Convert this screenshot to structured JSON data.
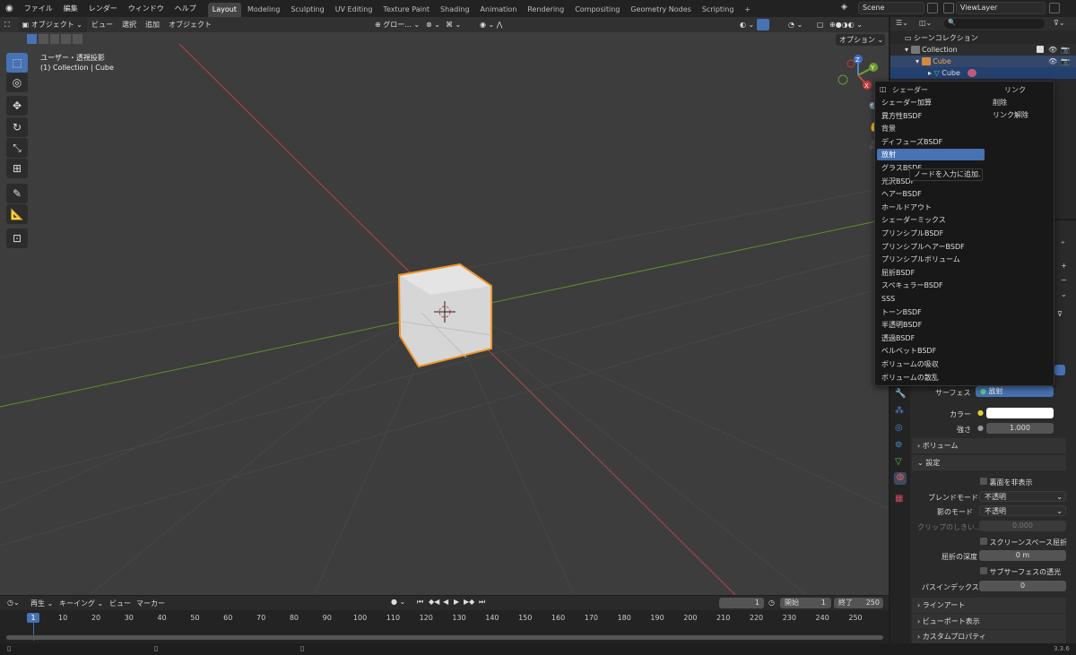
{
  "topbar": {
    "menus": [
      "ファイル",
      "編集",
      "レンダー",
      "ウィンドウ",
      "ヘルプ"
    ],
    "workspaces": [
      "Layout",
      "Modeling",
      "Sculpting",
      "UV Editing",
      "Texture Paint",
      "Shading",
      "Animation",
      "Rendering",
      "Compositing",
      "Geometry Nodes",
      "Scripting"
    ],
    "add_tab": "+",
    "scene": "Scene",
    "viewlayer": "ViewLayer"
  },
  "viewport": {
    "mode": "オブジェクト",
    "menus": [
      "ビュー",
      "選択",
      "追加",
      "オブジェクト"
    ],
    "transform": "グロー...",
    "options": "オプション",
    "title": "ユーザー・透視投影",
    "subtitle": "(1) Collection | Cube",
    "axes": {
      "x": "X",
      "y": "Y",
      "z": "Z"
    }
  },
  "outliner": {
    "scene_collection": "シーンコレクション",
    "collection": "Collection",
    "cube": "Cube",
    "mesh": "Cube"
  },
  "menu": {
    "col1_header": "シェーダー",
    "col2_header": "リンク",
    "items": [
      "シェーダー加算",
      "異方性BSDF",
      "背景",
      "ディフューズBSDF",
      "放射",
      "グラスBSDF",
      "光沢BSDF",
      "ヘアーBSDF",
      "ホールドアウト",
      "シェーダーミックス",
      "プリンシプルBSDF",
      "プリンシプルヘアーBSDF",
      "プリンシプルボリューム",
      "屈折BSDF",
      "スペキュラーBSDF",
      "SSS",
      "トーンBSDF",
      "半透明BSDF",
      "透過BSDF",
      "ベルベットBSDF",
      "ボリュームの吸収",
      "ボリュームの散乱"
    ],
    "col2_items": [
      "削除",
      "リンク解除"
    ],
    "highlighted_index": 4,
    "tooltip": "ノードを入力に追加."
  },
  "properties": {
    "surface_label": "サーフェス",
    "surface_value": "放射",
    "color_label": "カラー",
    "strength_label": "強さ",
    "strength_value": "1.000",
    "volume": "ボリューム",
    "settings": "設定",
    "backface": "裏面を非表示",
    "blend_label": "ブレンドモード",
    "blend_value": "不透明",
    "shadow_label": "影のモード",
    "shadow_value": "不透明",
    "clip_label": "クリップのしきい...",
    "clip_value": "0.000",
    "ssr": "スクリーンスペース屈折",
    "refr_depth_label": "屈折の深度",
    "refr_depth_value": "0 m",
    "subsurface": "サブサーフェスの透光",
    "pass_index_label": "パスインデックス",
    "pass_index_value": "0",
    "line_art": "ラインアート",
    "viewport_display": "ビューポート表示",
    "custom_props": "カスタムプロパティ"
  },
  "timeline": {
    "menus": [
      "再生",
      "キーイング",
      "ビュー",
      "マーカー"
    ],
    "current_frame": "1",
    "start_label": "開始",
    "start_value": "1",
    "end_label": "終了",
    "end_value": "250",
    "ticks": [
      "1",
      "10",
      "20",
      "30",
      "40",
      "50",
      "60",
      "70",
      "80",
      "90",
      "100",
      "110",
      "120",
      "130",
      "140",
      "150",
      "160",
      "170",
      "180",
      "190",
      "200",
      "210",
      "220",
      "230",
      "240",
      "250"
    ]
  },
  "status": {
    "version": "3.3.6"
  },
  "colors": {
    "accent": "#4772b3",
    "cube_outline": "#f0962b",
    "x_axis": "#c84a4a",
    "y_axis": "#6b9a2e"
  }
}
